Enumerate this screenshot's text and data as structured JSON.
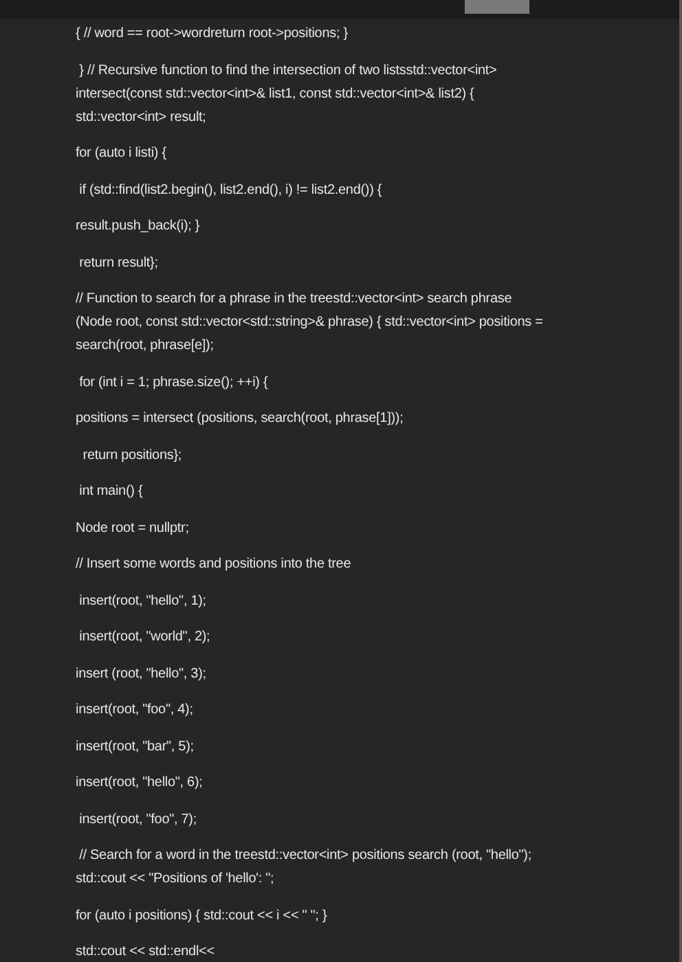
{
  "paragraphs": [
    {
      "lines": [
        "{ // word == root->wordreturn root->positions; }"
      ]
    },
    {
      "lines": [
        " } // Recursive function to find the intersection of two listsstd::vector<int>",
        "intersect(const std::vector<int>& list1, const std::vector<int>& list2) {",
        "std::vector<int> result;"
      ]
    },
    {
      "lines": [
        "for (auto i listi) {"
      ]
    },
    {
      "lines": [
        " if (std::find(list2.begin(), list2.end(), i) != list2.end()) {"
      ]
    },
    {
      "lines": [
        "result.push_back(i); }"
      ]
    },
    {
      "lines": [
        " return result};"
      ]
    },
    {
      "lines": [
        "// Function to search for a phrase in the treestd::vector<int> search phrase",
        "(Node root, const std::vector<std::string>& phrase) { std::vector<int> positions =",
        "search(root, phrase[e]);"
      ]
    },
    {
      "lines": [
        " for (int i = 1; phrase.size(); ++i) {"
      ]
    },
    {
      "lines": [
        "positions = intersect (positions, search(root, phrase[1]));"
      ]
    },
    {
      "lines": [
        "  return positions};"
      ]
    },
    {
      "lines": [
        " int main() {"
      ]
    },
    {
      "lines": [
        "Node root = nullptr;"
      ]
    },
    {
      "lines": [
        "// Insert some words and positions into the tree"
      ]
    },
    {
      "lines": [
        " insert(root, \"hello\", 1);"
      ]
    },
    {
      "lines": [
        " insert(root, \"world\", 2);"
      ]
    },
    {
      "lines": [
        "insert (root, \"hello\", 3);"
      ]
    },
    {
      "lines": [
        "insert(root, \"foo\", 4);"
      ]
    },
    {
      "lines": [
        "insert(root, \"bar\", 5);"
      ]
    },
    {
      "lines": [
        "insert(root, \"hello\", 6);"
      ]
    },
    {
      "lines": [
        " insert(root, \"foo\", 7);"
      ]
    },
    {
      "lines": [
        " // Search for a word in the treestd::vector<int> positions search (root, \"hello\");",
        "std::cout << \"Positions of 'hello': \";"
      ]
    },
    {
      "lines": [
        "for (auto i positions) { std::cout << i << \" \"; }"
      ]
    },
    {
      "lines": [
        "std::cout << std::endl<<"
      ]
    }
  ]
}
